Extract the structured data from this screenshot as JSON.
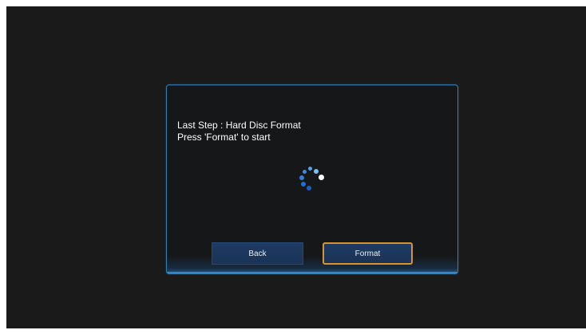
{
  "dialog": {
    "title": "Last Step : Hard Disc Format",
    "instruction": "Press 'Format' to start",
    "spinner_icon": "loading-spinner-icon"
  },
  "buttons": {
    "back_label": "Back",
    "format_label": "Format"
  },
  "colors": {
    "background": "#1a1a1a",
    "dialog_border": "#2f7fb5",
    "button_fill": "#1f3b63",
    "focus_border": "#d9932c",
    "spinner_blue": "#1e6fd9",
    "spinner_head": "#ffffff"
  }
}
